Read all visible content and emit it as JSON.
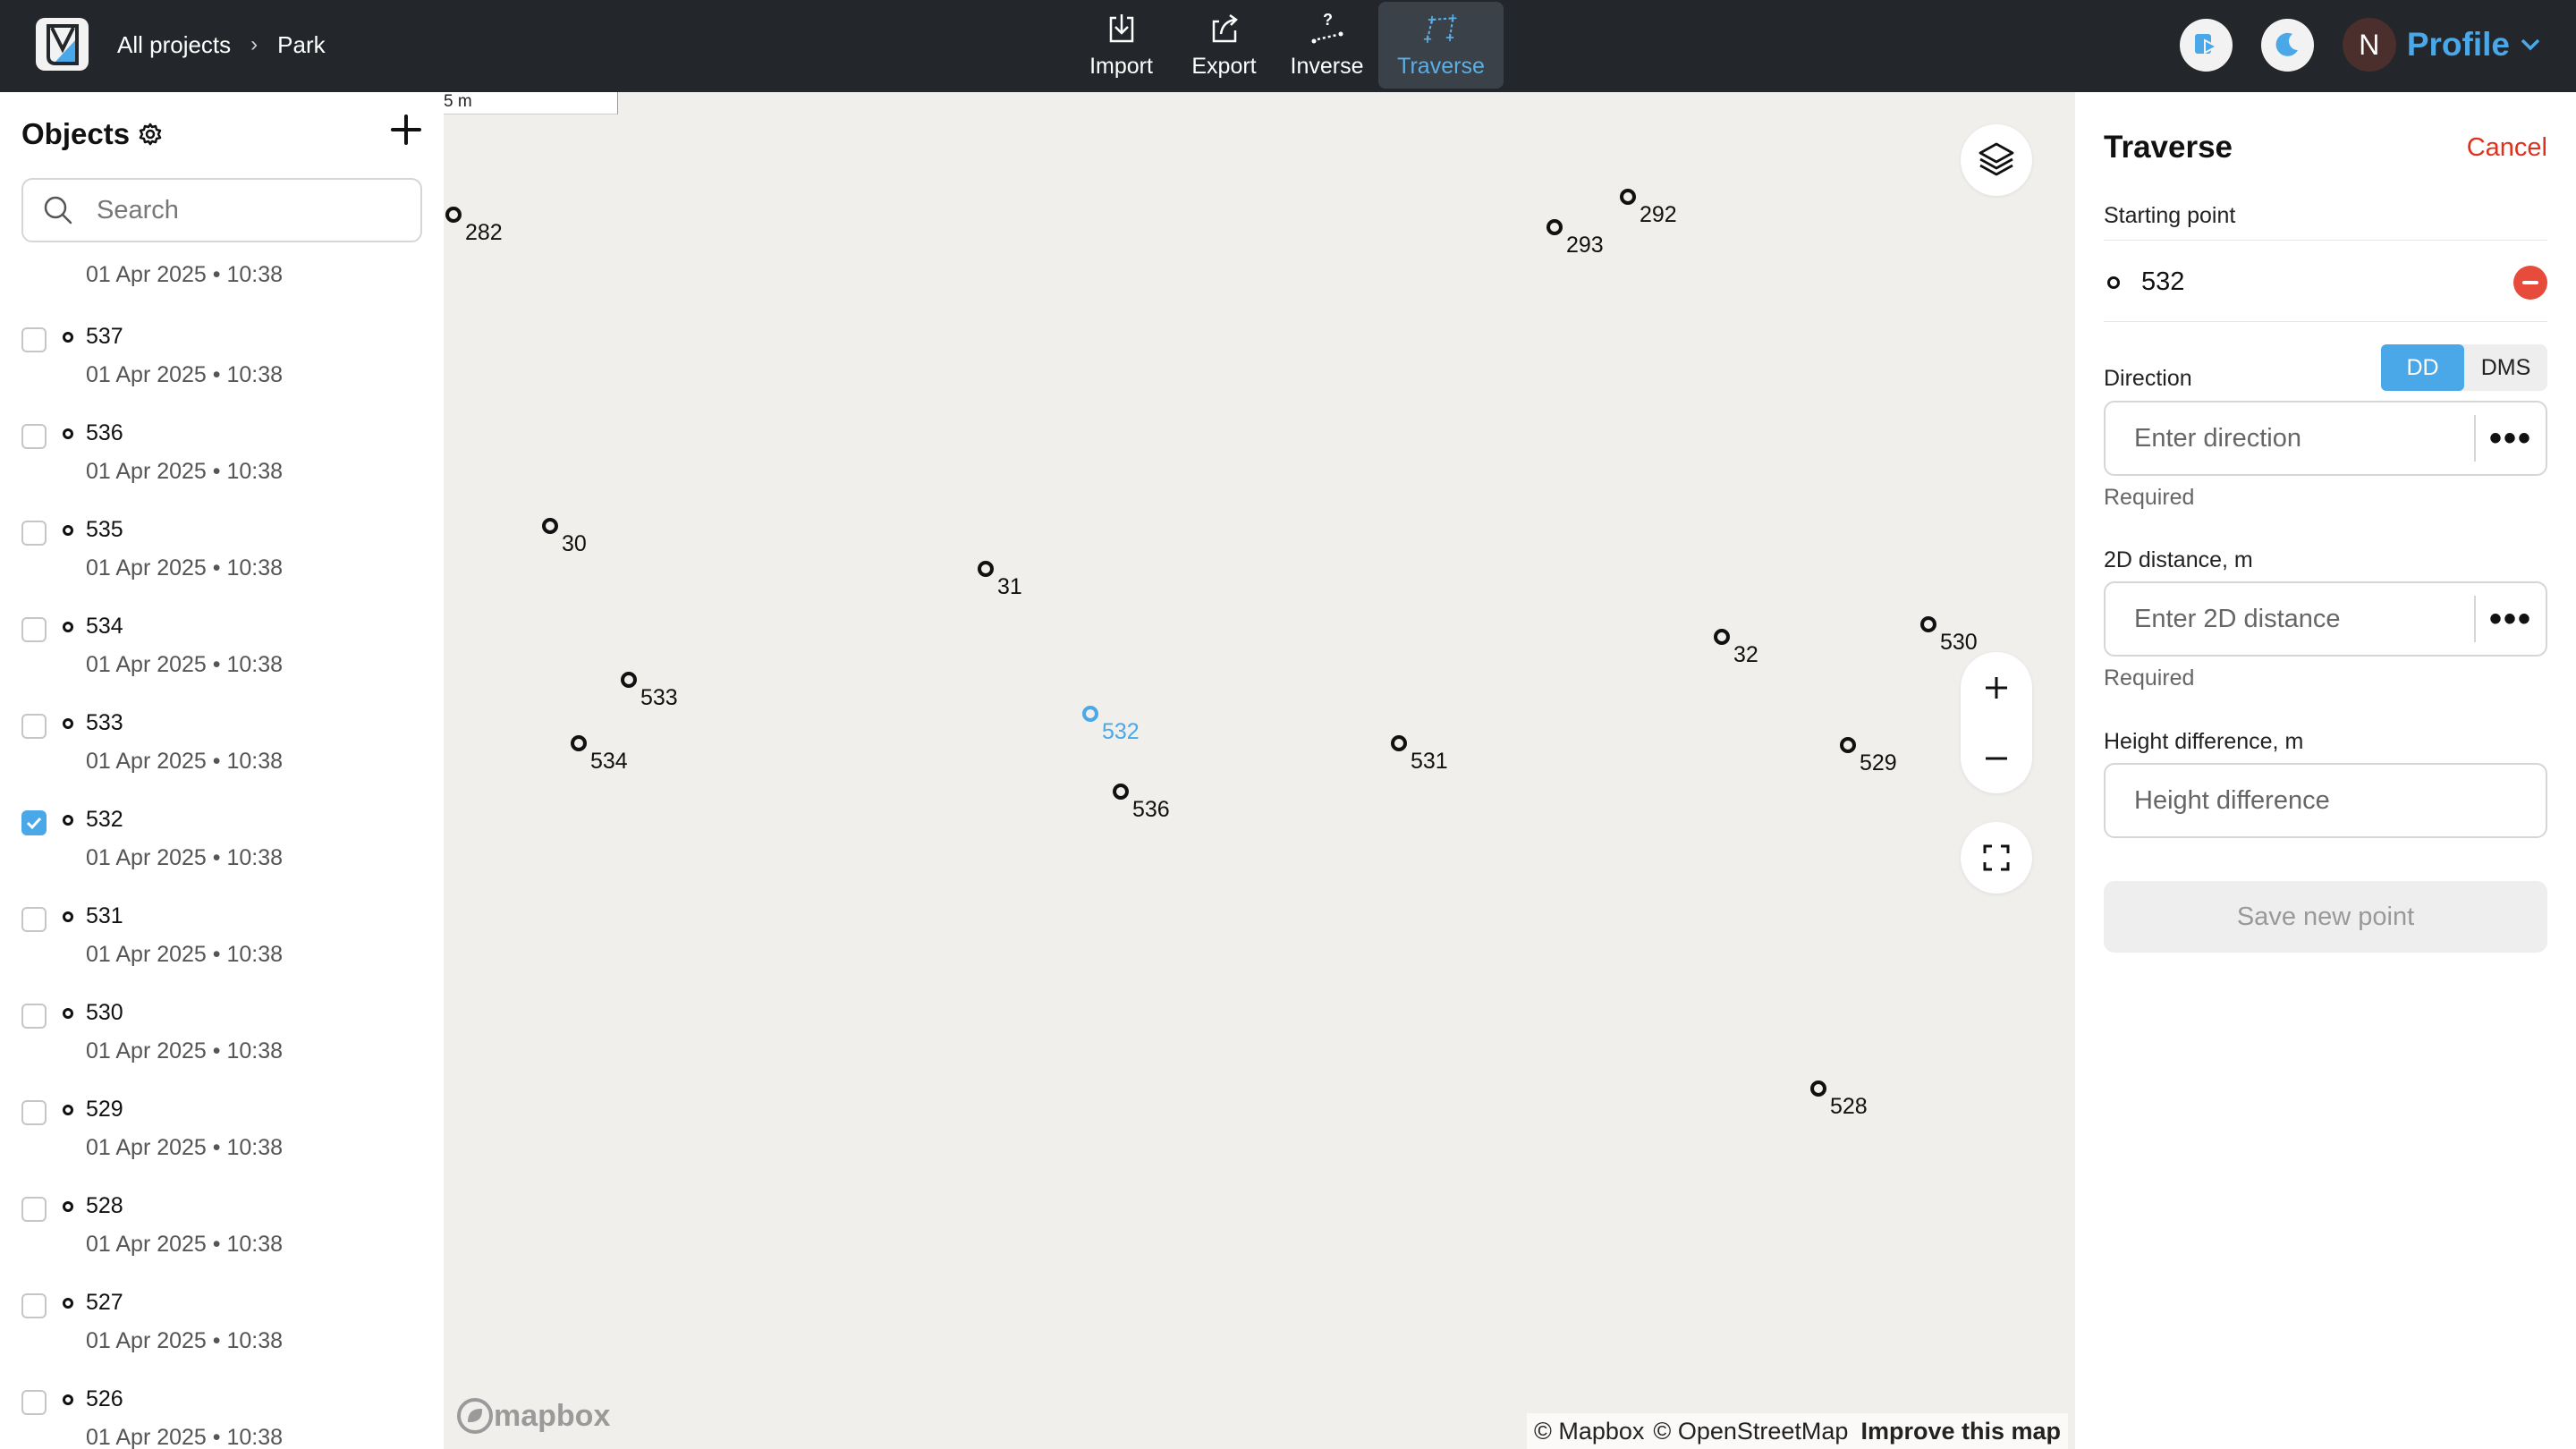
{
  "header": {
    "breadcrumb": {
      "root": "All projects",
      "separator": "›",
      "current": "Park"
    },
    "tools": [
      {
        "label": "Import",
        "icon": "import-icon"
      },
      {
        "label": "Export",
        "icon": "export-icon"
      },
      {
        "label": "Inverse",
        "icon": "inverse-icon"
      },
      {
        "label": "Traverse",
        "icon": "traverse-icon",
        "active": true
      }
    ],
    "avatar_initial": "N",
    "profile_label": "Profile"
  },
  "objects": {
    "title": "Objects",
    "search_placeholder": "Search",
    "top_partial_date": "01 Apr 2025 • 10:38",
    "items": [
      {
        "name": "537",
        "date": "01 Apr 2025 • 10:38",
        "checked": false
      },
      {
        "name": "536",
        "date": "01 Apr 2025 • 10:38",
        "checked": false
      },
      {
        "name": "535",
        "date": "01 Apr 2025 • 10:38",
        "checked": false
      },
      {
        "name": "534",
        "date": "01 Apr 2025 • 10:38",
        "checked": false
      },
      {
        "name": "533",
        "date": "01 Apr 2025 • 10:38",
        "checked": false
      },
      {
        "name": "532",
        "date": "01 Apr 2025 • 10:38",
        "checked": true
      },
      {
        "name": "531",
        "date": "01 Apr 2025 • 10:38",
        "checked": false
      },
      {
        "name": "530",
        "date": "01 Apr 2025 • 10:38",
        "checked": false
      },
      {
        "name": "529",
        "date": "01 Apr 2025 • 10:38",
        "checked": false
      },
      {
        "name": "528",
        "date": "01 Apr 2025 • 10:38",
        "checked": false
      },
      {
        "name": "527",
        "date": "01 Apr 2025 • 10:38",
        "checked": false
      },
      {
        "name": "526",
        "date": "01 Apr 2025 • 10:38",
        "checked": false
      }
    ]
  },
  "map": {
    "scale_label": "5 m",
    "points": [
      "282",
      "292",
      "293",
      "30",
      "31",
      "32",
      "530",
      "533",
      "532",
      "531",
      "534",
      "536",
      "529",
      "528"
    ],
    "selected_point": "532",
    "attribution": {
      "mapbox": "© Mapbox",
      "osm": "© OpenStreetMap",
      "improve": "Improve this map"
    },
    "logo_text": "mapbox"
  },
  "traverse": {
    "title": "Traverse",
    "cancel_label": "Cancel",
    "starting_point_label": "Starting point",
    "starting_point_value": "532",
    "direction_label": "Direction",
    "unit_options": [
      "DD",
      "DMS"
    ],
    "unit_selected": "DD",
    "direction_placeholder": "Enter direction",
    "direction_required": "Required",
    "distance_label": "2D distance, m",
    "distance_placeholder": "Enter 2D distance",
    "distance_required": "Required",
    "height_label": "Height difference, m",
    "height_placeholder": "Height difference",
    "more_label": "•••",
    "save_label": "Save new point"
  },
  "colors": {
    "accent": "#4aa8e8",
    "danger": "#e0301e",
    "topbar": "#23272b",
    "map_bg": "#f0efec"
  }
}
